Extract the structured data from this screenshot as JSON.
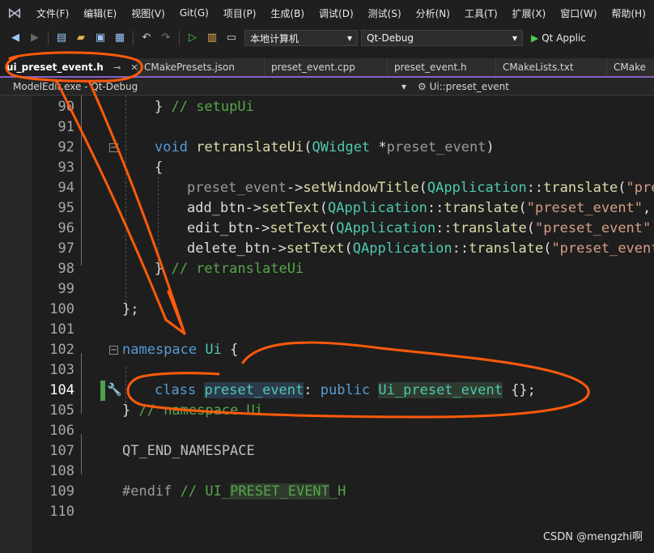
{
  "menu": [
    "文件(F)",
    "编辑(E)",
    "视图(V)",
    "Git(G)",
    "项目(P)",
    "生成(B)",
    "调试(D)",
    "测试(S)",
    "分析(N)",
    "工具(T)",
    "扩展(X)",
    "窗口(W)",
    "帮助(H)"
  ],
  "toolbar": {
    "target_machine": "本地计算机",
    "configuration": "Qt-Debug",
    "run_label": "Qt Applic"
  },
  "tabs": [
    {
      "label": "ui_preset_event.h",
      "active": true,
      "pin": "⊸",
      "close": "✕"
    },
    {
      "label": "CMakePresets.json"
    },
    {
      "label": "preset_event.cpp"
    },
    {
      "label": "preset_event.h"
    },
    {
      "label": "CMakeLists.txt"
    },
    {
      "label": "CMake"
    }
  ],
  "navbar": {
    "project": "ModelEdit.exe - Qt-Debug",
    "scope": "Ui::preset_event"
  },
  "code": {
    "line_numbers": [
      "90",
      "91",
      "92",
      "93",
      "94",
      "95",
      "96",
      "97",
      "98",
      "99",
      "100",
      "101",
      "102",
      "103",
      "104",
      "105",
      "106",
      "107",
      "108",
      "109",
      "110"
    ],
    "l90": {
      "brace": "} ",
      "comment": "// setupUi"
    },
    "l92": {
      "kw": "void",
      "fn": "retranslateUi",
      "p1": "(",
      "type": "QWidget",
      "star": " *",
      "param": "preset_event",
      "p2": ")"
    },
    "l93": {
      "text": "{"
    },
    "l94": {
      "var": "preset_event",
      "arrow": "->",
      "fn": "setWindowTitle",
      "p1": "(",
      "type": "QApplication",
      "sep": "::",
      "fn2": "translate",
      "p2": "(",
      "str": "\"pre"
    },
    "l95": {
      "var": "add_btn",
      "arrow": "->",
      "fn": "setText",
      "p1": "(",
      "type": "QApplication",
      "sep": "::",
      "fn2": "translate",
      "p2": "(",
      "str": "\"preset_event\"",
      "tail": ", \""
    },
    "l96": {
      "var": "edit_btn",
      "arrow": "->",
      "fn": "setText",
      "p1": "(",
      "type": "QApplication",
      "sep": "::",
      "fn2": "translate",
      "p2": "(",
      "str": "\"preset_event\"",
      "tail": ","
    },
    "l97": {
      "var": "delete_btn",
      "arrow": "->",
      "fn": "setText",
      "p1": "(",
      "type": "QApplication",
      "sep": "::",
      "fn2": "translate",
      "p2": "(",
      "str": "\"preset_event"
    },
    "l98": {
      "brace": "} ",
      "comment": "// retranslateUi"
    },
    "l100": {
      "text": "};"
    },
    "l102": {
      "kw": "namespace",
      "name": " Ui ",
      "brace": "{"
    },
    "l104": {
      "kw": "class",
      "cls": "preset_event",
      "colon": ": ",
      "kw2": "public",
      "base": "Ui_preset_event",
      "tail": " {};"
    },
    "l105": {
      "brace": "} ",
      "comment": "// namespace Ui"
    },
    "l107": {
      "macro": "QT_END_NAMESPACE"
    },
    "l109": {
      "pp": "#endif",
      "comment": " // UI_",
      "cmhl": "PRESET_EVENT",
      "comment2": "_H"
    }
  },
  "watermark": "CSDN @mengzhi啊",
  "colors": {
    "annotation": "#ff5a0a",
    "accent": "#8661c5",
    "changed_line": "#4ea04e"
  }
}
